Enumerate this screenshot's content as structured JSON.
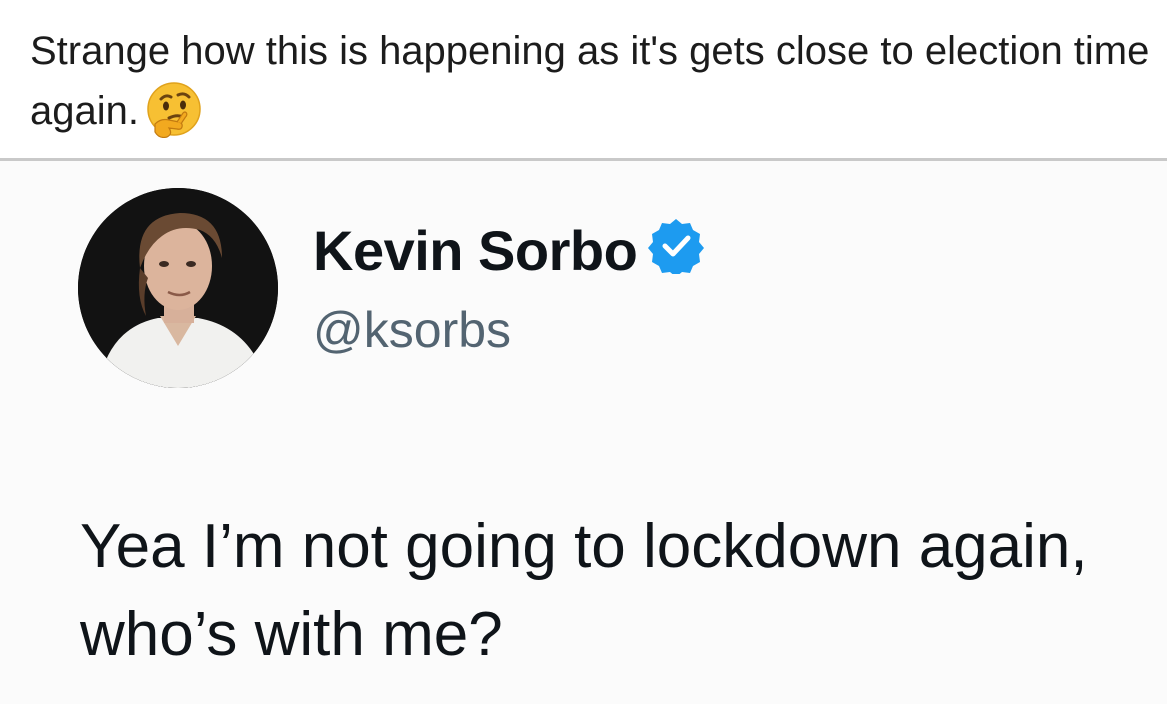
{
  "post": {
    "caption": "Strange how this is happening as it's gets close to election time again.",
    "emoji_icon": "thinking-face-icon"
  },
  "tweet": {
    "author_name": "Kevin Sorbo",
    "verified_icon": "verified-badge-icon",
    "handle": "@ksorbs",
    "text": "Yea I’m not going to lockdown again, who’s with me?"
  },
  "colors": {
    "verified_blue": "#1d9bf0",
    "divider": "#c9c9c9",
    "handle_gray": "#536471"
  }
}
